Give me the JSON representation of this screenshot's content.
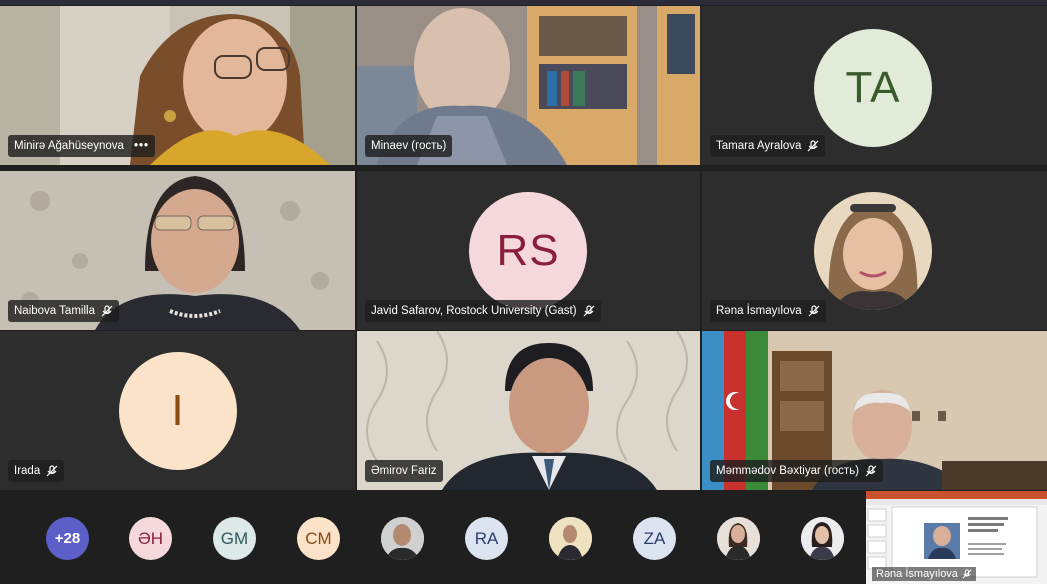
{
  "tiles": [
    {
      "name": "Minirə Ağahüseynova",
      "more": "•••"
    },
    {
      "name": "Minaev (гость)"
    },
    {
      "name": "Tamara Ayralova",
      "initials": "TA"
    },
    {
      "name": "Naibova Tamilla"
    },
    {
      "name": "Javid Safarov, Rostock University (Gast)",
      "initials": "RS"
    },
    {
      "name": "Rəna İsmayılova"
    },
    {
      "name": "Irada",
      "initials": "I"
    },
    {
      "name": "Əmirov Fariz"
    },
    {
      "name": "Məmmədov Bəxtiyar (гость)"
    }
  ],
  "roster": {
    "overflow_count": "+28",
    "avatars": [
      {
        "initials": "ƏH"
      },
      {
        "initials": "GM"
      },
      {
        "initials": "CM"
      },
      {
        "initials": ""
      },
      {
        "initials": "RA"
      },
      {
        "initials": ""
      },
      {
        "initials": "ZA"
      },
      {
        "initials": ""
      },
      {
        "initials": ""
      }
    ]
  },
  "share": {
    "presenter": "Rəna İsmayılova"
  },
  "colors": {
    "ta_bg": "#e2ead8",
    "ta_fg": "#3b5b2a",
    "rs_bg": "#f5d8dc",
    "rs_fg": "#8a1f3c",
    "i_bg": "#fbe3c9",
    "i_fg": "#8a4a12",
    "overflow_bg": "#5b5fc7"
  }
}
